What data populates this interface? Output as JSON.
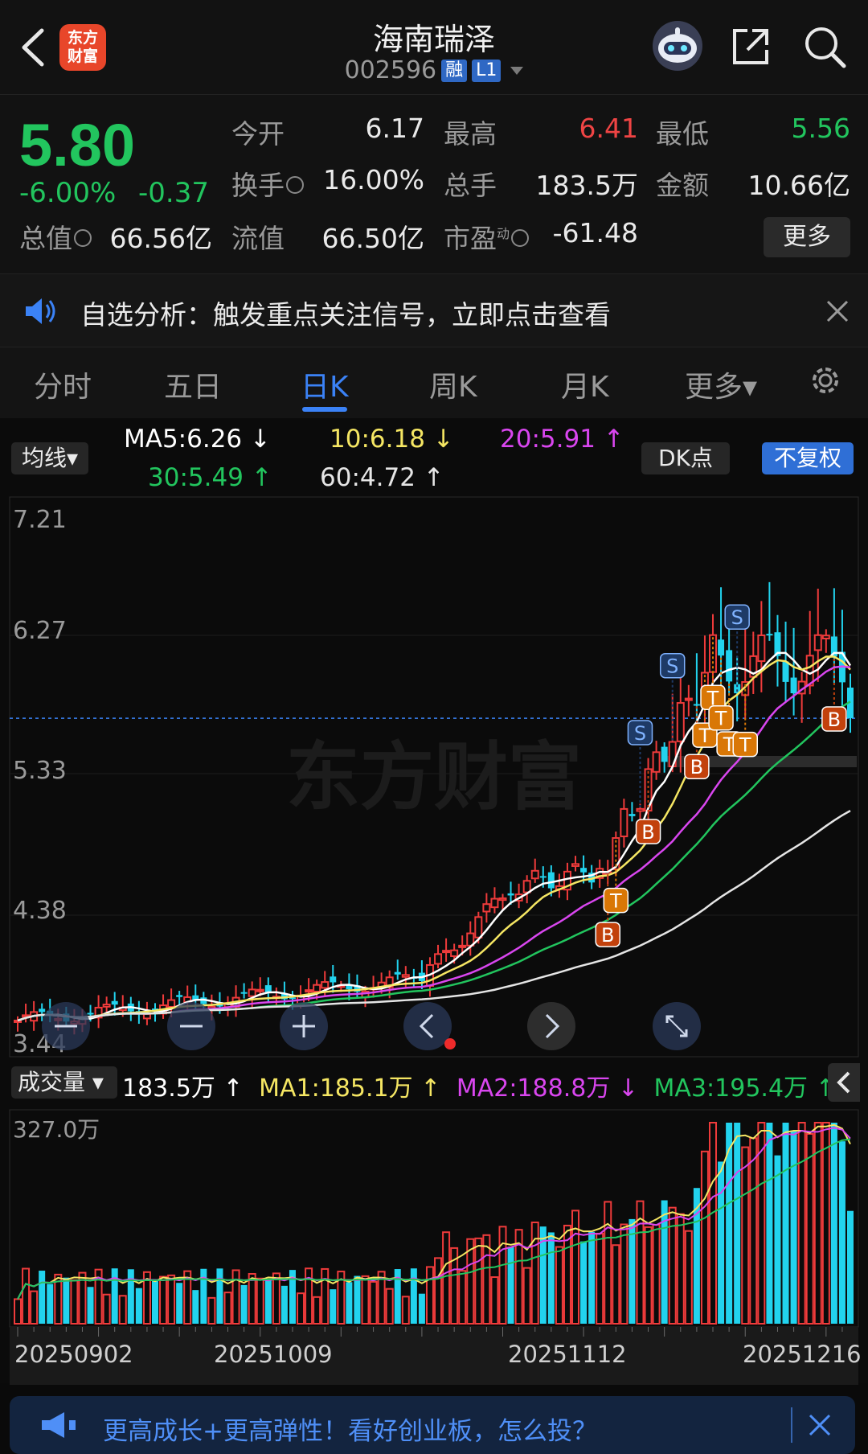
{
  "header": {
    "title": "海南瑞泽",
    "code": "002596",
    "badge_rong": "融",
    "badge_level": "L1",
    "logo_text_line1": "东方",
    "logo_text_line2": "财富"
  },
  "quote": {
    "price": "5.80",
    "change_pct": "-6.00%",
    "change_val": "-0.37",
    "fields": [
      {
        "label": "今开",
        "value": "6.17",
        "color": "#eaeaea"
      },
      {
        "label": "最高",
        "value": "6.41",
        "color": "#ef4444"
      },
      {
        "label": "最低",
        "value": "5.56",
        "color": "#22c55e"
      },
      {
        "label": "换手",
        "value": "16.00%",
        "color": "#eaeaea"
      },
      {
        "label": "总手",
        "value": "183.5万",
        "color": "#eaeaea"
      },
      {
        "label": "金额",
        "value": "10.66亿",
        "color": "#eaeaea"
      },
      {
        "label": "总值",
        "value": "66.56亿",
        "color": "#eaeaea"
      },
      {
        "label": "流值",
        "value": "66.50亿",
        "color": "#eaeaea"
      },
      {
        "label": "市盈",
        "superscript": "动",
        "value": "-61.48",
        "color": "#eaeaea"
      }
    ],
    "more_label": "更多"
  },
  "alert": {
    "text": "自选分析：触发重点关注信号，立即点击查看"
  },
  "tabs": [
    {
      "label": "分时"
    },
    {
      "label": "五日"
    },
    {
      "label": "日K",
      "active": true
    },
    {
      "label": "周K"
    },
    {
      "label": "月K"
    },
    {
      "label": "更多▾"
    }
  ],
  "chart_controls": {
    "ma_selector": "均线▾",
    "dk_label": "DK点",
    "fq_label": "不复权",
    "ma_legend": [
      {
        "text": "MA5:6.26 ↓",
        "color": "#ffffff"
      },
      {
        "text": "10:6.18 ↓",
        "color": "#f5e663"
      },
      {
        "text": "20:5.91 ↑",
        "color": "#d946ef"
      },
      {
        "text": "30:5.49 ↑",
        "color": "#22c55e"
      },
      {
        "text": "60:4.72 ↑",
        "color": "#e5e5e5"
      }
    ],
    "vol_selector": "成交量 ▾",
    "vol_legend": [
      {
        "text": "183.5万 ↑",
        "color": "#ffffff"
      },
      {
        "text": "MA1:185.1万 ↑",
        "color": "#f5e663"
      },
      {
        "text": "MA2:188.8万 ↓",
        "color": "#d946ef"
      },
      {
        "text": "MA3:195.4万 ↑",
        "color": "#22c55e"
      }
    ]
  },
  "chart_data": {
    "type": "candlestick",
    "price_axis_labels": [
      "7.21",
      "6.27",
      "5.33",
      "4.38",
      "3.44"
    ],
    "ylim": [
      3.44,
      7.21
    ],
    "current_price_line": 5.8,
    "volume_axis_label": "327.0万",
    "volume_max": 327.0,
    "x_labels": [
      "20250902",
      "20251009",
      "20251112",
      "20251216"
    ],
    "watermark": "东方财富",
    "signals": [
      {
        "type": "S",
        "index": 77
      },
      {
        "type": "S",
        "index": 81
      },
      {
        "type": "S",
        "index": 89
      },
      {
        "type": "B",
        "index": 73
      },
      {
        "type": "T",
        "index": 74
      },
      {
        "type": "B",
        "index": 78
      },
      {
        "type": "B",
        "index": 84
      },
      {
        "type": "T",
        "index": 85
      },
      {
        "type": "T",
        "index": 86
      },
      {
        "type": "T",
        "index": 87
      },
      {
        "type": "T",
        "index": 88
      },
      {
        "type": "T",
        "index": 90
      },
      {
        "type": "B",
        "index": 101
      }
    ]
  },
  "banner": {
    "text": "更高成长+更高弹性！看好创业板，怎么投？"
  }
}
